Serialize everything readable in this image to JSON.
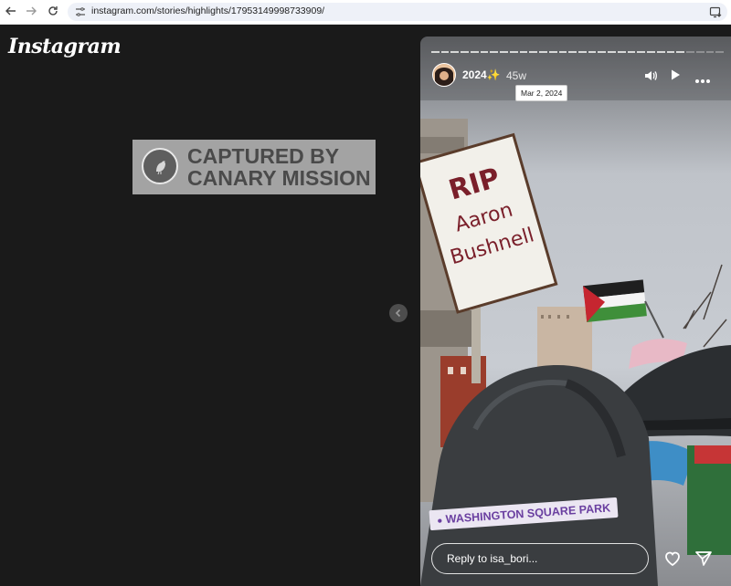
{
  "browser": {
    "url": "instagram.com/stories/highlights/17953149998733909/",
    "icons": [
      "back-arrow",
      "forward-arrow",
      "reload",
      "site-info",
      "install-app"
    ]
  },
  "app": {
    "logo": "Instagram",
    "watermark": {
      "line1": "CAPTURED BY",
      "line2": "CANARY MISSION"
    }
  },
  "story": {
    "username": "2024✨",
    "time_ago": "45w",
    "date_tooltip": "Mar 2, 2024",
    "location": "WASHINGTON SQUARE PARK",
    "sign_text": "RIP Aaron Bushnell",
    "reply_placeholder": "Reply to isa_bori...",
    "controls": [
      "mute",
      "play",
      "more-options"
    ],
    "actions": [
      "like",
      "share"
    ],
    "segments_total": 30,
    "segments_viewed": 26
  },
  "colors": {
    "page_bg": "#1a1a1a",
    "sticker_text": "#6a3fa0",
    "watermark_bg": "#a3a3a3"
  }
}
